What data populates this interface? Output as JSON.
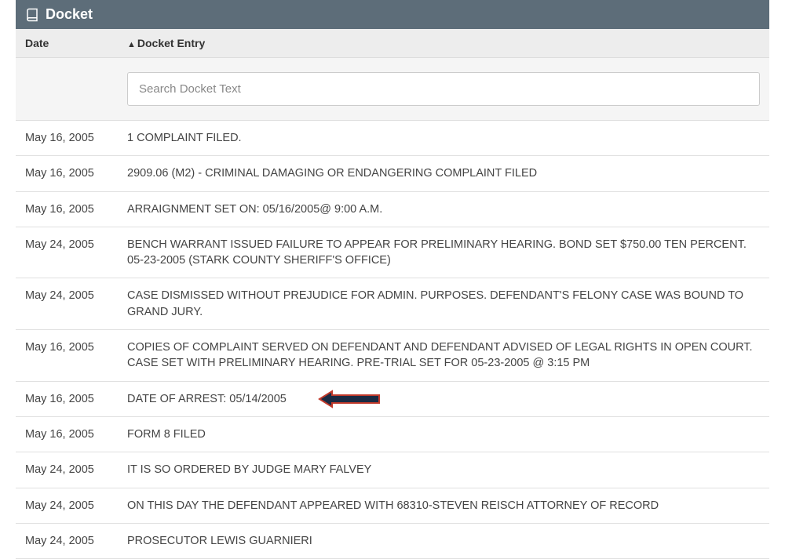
{
  "panel": {
    "title": "Docket"
  },
  "columns": {
    "date": "Date",
    "entry": "Docket Entry"
  },
  "search": {
    "placeholder": "Search Docket Text"
  },
  "rows": [
    {
      "date": "May 16, 2005",
      "entry": "1 COMPLAINT FILED."
    },
    {
      "date": "May 16, 2005",
      "entry": "2909.06 (M2) - CRIMINAL DAMAGING OR ENDANGERING COMPLAINT FILED"
    },
    {
      "date": "May 16, 2005",
      "entry": "ARRAIGNMENT SET ON: 05/16/2005@ 9:00 A.M."
    },
    {
      "date": "May 24, 2005",
      "entry": "BENCH WARRANT ISSUED FAILURE TO APPEAR FOR PRELIMINARY HEARING. BOND SET $750.00 TEN PERCENT. 05-23-2005 (STARK COUNTY SHERIFF'S OFFICE)"
    },
    {
      "date": "May 24, 2005",
      "entry": "CASE DISMISSED WITHOUT PREJUDICE FOR ADMIN. PURPOSES. DEFENDANT'S FELONY CASE WAS BOUND TO GRAND JURY."
    },
    {
      "date": "May 16, 2005",
      "entry": "COPIES OF COMPLAINT SERVED ON DEFENDANT AND DEFENDANT ADVISED OF LEGAL RIGHTS IN OPEN COURT. CASE SET WITH PRELIMINARY HEARING. PRE-TRIAL SET FOR 05-23-2005 @ 3:15 PM"
    },
    {
      "date": "May 16, 2005",
      "entry": "DATE OF ARREST: 05/14/2005",
      "highlight": true
    },
    {
      "date": "May 16, 2005",
      "entry": "FORM 8 FILED"
    },
    {
      "date": "May 24, 2005",
      "entry": "IT IS SO ORDERED BY JUDGE MARY FALVEY"
    },
    {
      "date": "May 24, 2005",
      "entry": "ON THIS DAY THE DEFENDANT APPEARED WITH 68310-STEVEN REISCH ATTORNEY OF RECORD"
    },
    {
      "date": "May 24, 2005",
      "entry": "PROSECUTOR LEWIS GUARNIERI"
    }
  ]
}
